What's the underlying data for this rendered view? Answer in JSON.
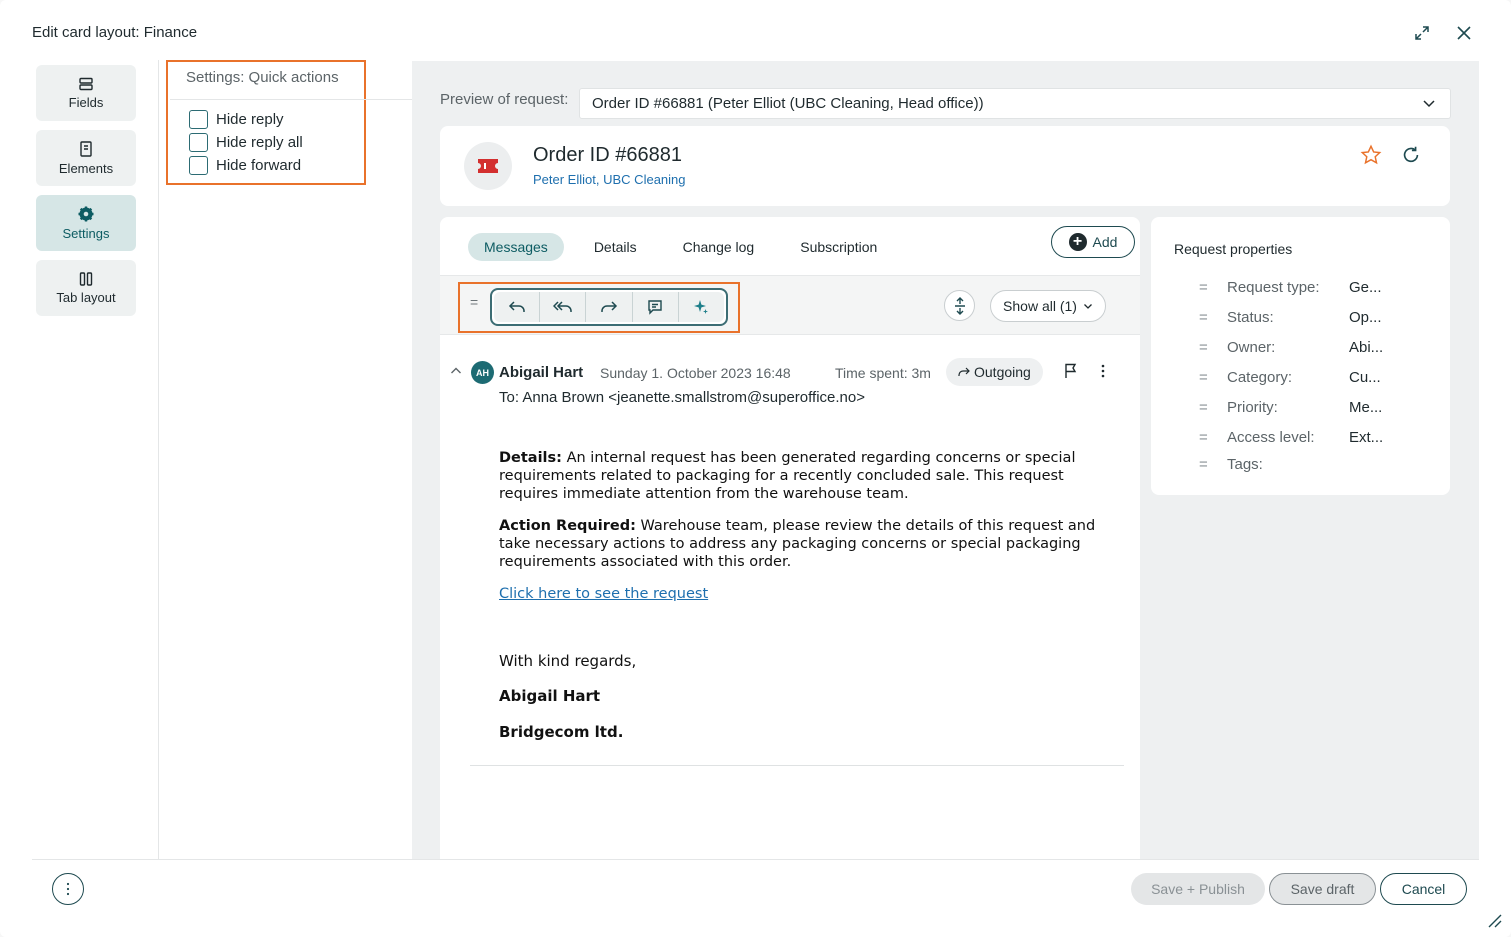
{
  "window": {
    "title": "Edit card layout: Finance"
  },
  "nav": {
    "items": [
      {
        "label": "Fields",
        "icon": "fields-icon"
      },
      {
        "label": "Elements",
        "icon": "elements-icon"
      },
      {
        "label": "Settings",
        "icon": "gear-icon",
        "active": true
      },
      {
        "label": "Tab layout",
        "icon": "tab-layout-icon"
      }
    ]
  },
  "settings": {
    "title": "Settings: Quick actions",
    "options": [
      {
        "label": "Hide reply",
        "checked": false
      },
      {
        "label": "Hide reply all",
        "checked": false
      },
      {
        "label": "Hide forward",
        "checked": false
      }
    ]
  },
  "preview": {
    "label": "Preview of request:",
    "selected": "Order ID #66881 (Peter Elliot (UBC Cleaning, Head office))"
  },
  "request": {
    "title": "Order ID #66881",
    "contact": "Peter Elliot",
    "company": "UBC Cleaning",
    "separator": ","
  },
  "tabs": [
    {
      "label": "Messages",
      "active": true
    },
    {
      "label": "Details"
    },
    {
      "label": "Change log"
    },
    {
      "label": "Subscription"
    }
  ],
  "add_button": {
    "label": "Add"
  },
  "toolbar": {
    "drag": "=",
    "show_all": "Show all (1)"
  },
  "message": {
    "initials": "AH",
    "sender": "Abigail Hart",
    "date": "Sunday 1. October 2023 16:48",
    "time_spent": "Time spent: 3m",
    "direction": "Outgoing",
    "to": "To: Anna Brown <jeanette.smallstrom@superoffice.no>",
    "details_label": "Details:",
    "details_text": " An internal request has been generated regarding concerns or special requirements related to packaging for a recently concluded sale. This request requires immediate attention from the warehouse team.",
    "action_label": "Action Required:",
    "action_text": " Warehouse team, please review the details of this request and take necessary actions to address any packaging concerns or special packaging requirements associated with this order.",
    "link": "Click here to see the request",
    "regards": "With kind regards,",
    "sig_name": "Abigail Hart",
    "sig_company": "Bridgecom ltd."
  },
  "properties": {
    "title": "Request properties",
    "rows": [
      {
        "key": "Request type:",
        "value": "Ge..."
      },
      {
        "key": "Status:",
        "value": "Op..."
      },
      {
        "key": "Owner:",
        "value": "Abi..."
      },
      {
        "key": "Category:",
        "value": "Cu..."
      },
      {
        "key": "Priority:",
        "value": "Me..."
      },
      {
        "key": "Access level:",
        "value": "Ext..."
      },
      {
        "key": "Tags:",
        "value": ""
      }
    ]
  },
  "footer": {
    "publish": "Save + Publish",
    "draft": "Save draft",
    "cancel": "Cancel"
  },
  "colors": {
    "accent": "#0d5c63",
    "highlight": "#e9722b",
    "link": "#1e6fae"
  }
}
